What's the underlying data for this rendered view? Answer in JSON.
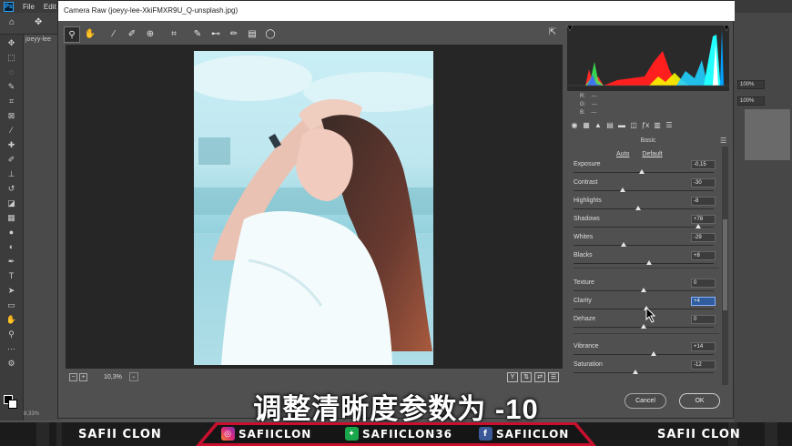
{
  "photoshop": {
    "menu": [
      "File",
      "Edit"
    ],
    "logo": "Ps",
    "doc_tab": "joeyy-lee",
    "zoom_status": "8,33%",
    "right_panel": {
      "pct1": "100%",
      "pct2": "100%"
    }
  },
  "dialog": {
    "title": "Camera Raw (joeyy-lee-XkiFMXR9U_Q-unsplash.jpg)",
    "tools": [
      "zoom-icon",
      "hand-icon",
      "white-balance-icon",
      "color-sampler-icon",
      "targeted-adjustment-icon",
      "crop-icon",
      "spot-removal-icon",
      "red-eye-icon",
      "adjustment-brush-icon",
      "graduated-filter-icon",
      "radial-filter-icon"
    ],
    "zoom_level": "10,3%",
    "rgb": {
      "r_label": "R:",
      "g_label": "G:",
      "b_label": "B:",
      "r": "---",
      "g": "---",
      "b": "---"
    },
    "panel_title": "Basic",
    "auto_label": "Auto",
    "default_label": "Default",
    "sliders": [
      {
        "label": "Exposure",
        "value": "-0,15",
        "pos": 0.49
      },
      {
        "label": "Contrast",
        "value": "-30",
        "pos": 0.35
      },
      {
        "label": "Highlights",
        "value": "-8",
        "pos": 0.46
      },
      {
        "label": "Shadows",
        "value": "+78",
        "pos": 0.89
      },
      {
        "label": "Whites",
        "value": "-29",
        "pos": 0.36
      },
      {
        "label": "Blacks",
        "value": "+8",
        "pos": 0.54
      },
      {
        "label": "Texture",
        "value": "0",
        "pos": 0.5
      },
      {
        "label": "Clarity",
        "value": "+4",
        "pos": 0.52
      },
      {
        "label": "Dehaze",
        "value": "0",
        "pos": 0.5
      },
      {
        "label": "Vibrance",
        "value": "+14",
        "pos": 0.57
      },
      {
        "label": "Saturation",
        "value": "-12",
        "pos": 0.44
      }
    ],
    "cancel_label": "Cancel",
    "ok_label": "OK"
  },
  "subtitle": "调整清晰度参数为 -10",
  "banner": {
    "left_brand": "SAFII CLON",
    "instagram": "SAFIICLON",
    "other": "SAFIICLON36",
    "facebook": "SAFIICLON",
    "right_brand": "SAFII CLON",
    "colors": {
      "red": "#c8102e",
      "dark": "#1b1b1b"
    }
  }
}
